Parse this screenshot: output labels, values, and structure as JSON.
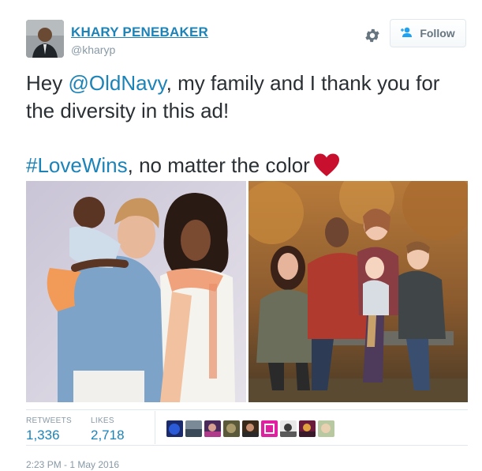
{
  "header": {
    "display_name": "KHARY PENEBAKER",
    "handle": "@kharyp",
    "follow_label": "Follow"
  },
  "tweet": {
    "text_part1": "Hey ",
    "mention": "@OldNavy",
    "text_part2": ", my family and I thank you for",
    "text_line2": "the diversity in this ad!",
    "hashtag": "#LoveWins",
    "text_part3": ", no matter the color",
    "emoji": "heart-icon"
  },
  "media": {
    "left_image": "old-navy-ad-photo",
    "right_image": "family-photo"
  },
  "stats": {
    "retweets_label": "RETWEETS",
    "retweets_value": "1,336",
    "likes_label": "LIKES",
    "likes_value": "2,718",
    "liker_avatar_count": 9
  },
  "footer": {
    "timestamp": "2:23 PM - 1 May 2016"
  },
  "colors": {
    "link": "#1c83b8",
    "text": "#292f33",
    "muted": "#8899a6",
    "heart": "#c8102e",
    "border": "#e1e8ed"
  }
}
